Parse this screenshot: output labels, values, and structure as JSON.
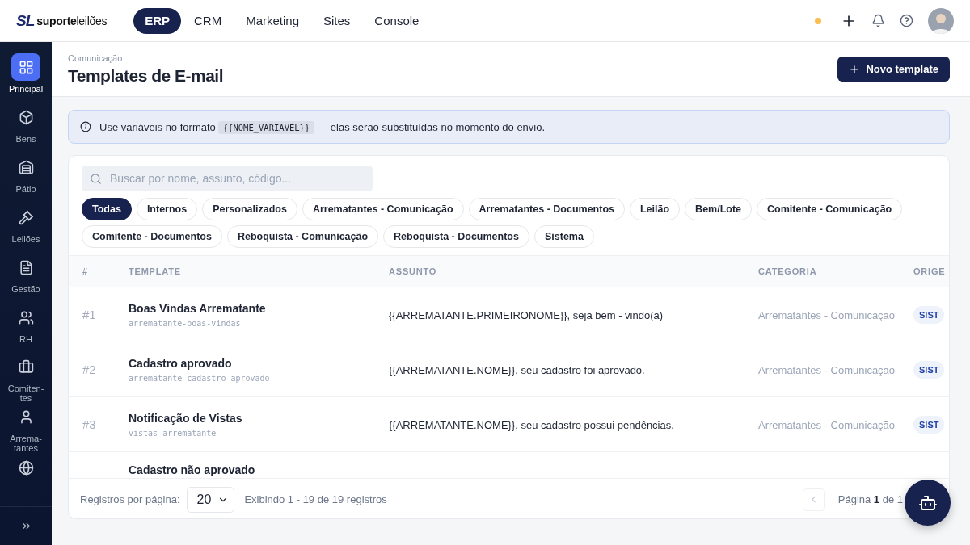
{
  "brand": {
    "mark": "SL",
    "name_bold": "suporte",
    "name_light": "leilões"
  },
  "top_tabs": [
    {
      "label": "ERP",
      "selected": true
    },
    {
      "label": "CRM",
      "selected": false
    },
    {
      "label": "Marketing",
      "selected": false
    },
    {
      "label": "Sites",
      "selected": false
    },
    {
      "label": "Console",
      "selected": false
    }
  ],
  "status_dot": {
    "color": "#fbbf4f"
  },
  "sidebar": {
    "items": [
      {
        "label": "Principal",
        "selected": true
      },
      {
        "label": "Bens",
        "selected": false
      },
      {
        "label": "Pátio",
        "selected": false
      },
      {
        "label": "Leilões",
        "selected": false
      },
      {
        "label": "Gestão",
        "selected": false
      },
      {
        "label": "RH",
        "selected": false
      },
      {
        "label": "Comiten-tes",
        "selected": false
      },
      {
        "label": "Arrema-tantes",
        "selected": false
      },
      {
        "selected": false
      }
    ]
  },
  "page": {
    "breadcrumb": "Comunicação",
    "title": "Templates de E-mail",
    "new_button": "Novo template"
  },
  "notice": {
    "before": "Use variáveis no formato",
    "code": "{{NOME_VARIAVEL}}",
    "after": "— elas serão substituídas no momento do envio."
  },
  "search": {
    "placeholder": "Buscar por nome, assunto, código..."
  },
  "filters": [
    {
      "label": "Todas",
      "selected": true
    },
    {
      "label": "Internos",
      "selected": false
    },
    {
      "label": "Personalizados",
      "selected": false
    },
    {
      "label": "Arrematantes - Comunicação",
      "selected": false
    },
    {
      "label": "Arrematantes - Documentos",
      "selected": false
    },
    {
      "label": "Leilão",
      "selected": false
    },
    {
      "label": "Bem/Lote",
      "selected": false
    },
    {
      "label": "Comitente - Comunicação",
      "selected": false
    },
    {
      "label": "Comitente - Documentos",
      "selected": false
    },
    {
      "label": "Reboquista - Comunicação",
      "selected": false
    },
    {
      "label": "Reboquista - Documentos",
      "selected": false
    },
    {
      "label": "Sistema",
      "selected": false
    }
  ],
  "table": {
    "columns": [
      "#",
      "TEMPLATE",
      "ASSUNTO",
      "CATEGORIA",
      "ORIGE"
    ],
    "rows": [
      {
        "num": "#1",
        "name": "Boas Vindas Arrematante",
        "code": "arrematante-boas-vindas",
        "subject": "{{ARREMATANTE.PRIMEIRONOME}}, seja bem - vindo(a)",
        "category": "Arrematantes - Comunicação",
        "origin": "SIST"
      },
      {
        "num": "#2",
        "name": "Cadastro aprovado",
        "code": "arrematante-cadastro-aprovado",
        "subject": "{{ARREMATANTE.NOME}}, seu cadastro foi aprovado.",
        "category": "Arrematantes - Comunicação",
        "origin": "SIST"
      },
      {
        "num": "#3",
        "name": "Notificação de Vistas",
        "code": "vistas-arrematante",
        "subject": "{{ARREMATANTE.NOME}}, seu cadastro possui pendências.",
        "category": "Arrematantes - Comunicação",
        "origin": "SIST"
      },
      {
        "name": "Cadastro não aprovado"
      }
    ]
  },
  "footer": {
    "per_page_label": "Registros por página:",
    "per_page": "20",
    "showing": "Exibindo 1 - 19 de 19 registros",
    "page_text": "Página **1** de 1"
  }
}
